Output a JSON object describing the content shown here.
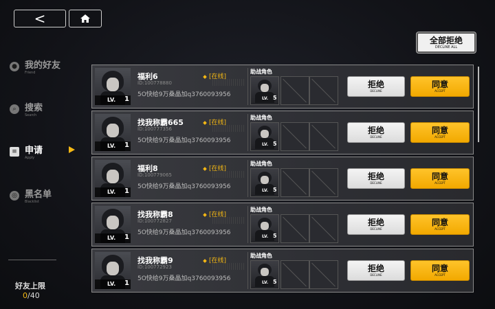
{
  "header": {
    "back_glyph": "<",
    "decline_all": {
      "label": "全部拒绝",
      "sub": "DECLINE ALL"
    }
  },
  "sidebar": {
    "items": [
      {
        "label": "我的好友",
        "sub": "Friend",
        "icon": "person-icon",
        "active": false
      },
      {
        "label": "搜索",
        "sub": "Search",
        "icon": "search-icon",
        "active": false
      },
      {
        "label": "申请",
        "sub": "Apply",
        "icon": "document-icon",
        "active": true
      },
      {
        "label": "黑名单",
        "sub": "Blacklist",
        "icon": "block-icon",
        "active": false
      }
    ],
    "limit_label": "好友上限",
    "limit_current": "0",
    "limit_max": "/40"
  },
  "requests": [
    {
      "name": "福利6",
      "id": "ID:100778880",
      "message": "5O快给9万桑晶加q3760093956",
      "status": "[在线]",
      "level": "1",
      "support_label": "助战角色",
      "support_level": "5",
      "lv_label": "LV.",
      "decline": "拒绝",
      "decline_sub": "DECLINE",
      "accept": "同意",
      "accept_sub": "ACCEPT"
    },
    {
      "name": "找我称霸665",
      "id": "ID:100777356",
      "message": "5O快给9万桑晶加q3760093956",
      "status": "[在线]",
      "level": "1",
      "support_label": "助战角色",
      "support_level": "5",
      "lv_label": "LV.",
      "decline": "拒绝",
      "decline_sub": "DECLINE",
      "accept": "同意",
      "accept_sub": "ACCEPT"
    },
    {
      "name": "福利8",
      "id": "ID:100779065",
      "message": "5O快给9万桑晶加q3760093956",
      "status": "[在线]",
      "level": "1",
      "support_label": "助战角色",
      "support_level": "5",
      "lv_label": "LV.",
      "decline": "拒绝",
      "decline_sub": "DECLINE",
      "accept": "同意",
      "accept_sub": "ACCEPT"
    },
    {
      "name": "找我称霸8",
      "id": "ID:100772827",
      "message": "5O快给9万桑晶加q3760093956",
      "status": "[在线]",
      "level": "1",
      "support_label": "助战角色",
      "support_level": "5",
      "lv_label": "LV.",
      "decline": "拒绝",
      "decline_sub": "DECLINE",
      "accept": "同意",
      "accept_sub": "ACCEPT"
    },
    {
      "name": "找我称霸9",
      "id": "ID:100772923",
      "message": "5O快给9万桑晶加q3760093956",
      "status": "[在线]",
      "level": "1",
      "support_label": "助战角色",
      "support_level": "5",
      "lv_label": "LV.",
      "decline": "拒绝",
      "decline_sub": "DECLINE",
      "accept": "同意",
      "accept_sub": "ACCEPT"
    }
  ],
  "colors": {
    "accent": "#f5b814",
    "online": "#f5b814"
  }
}
